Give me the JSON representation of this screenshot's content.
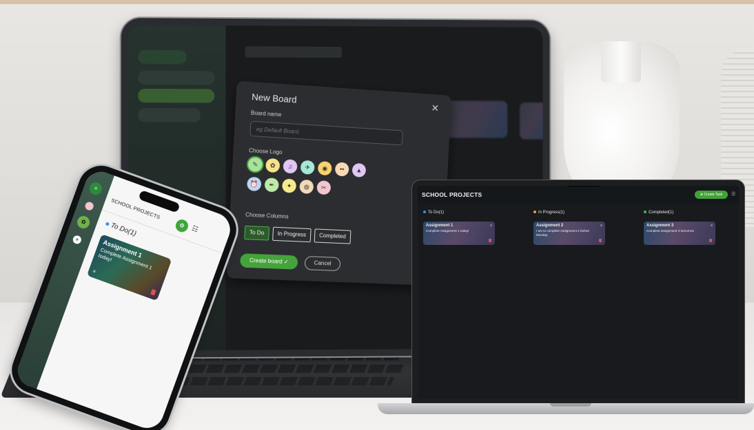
{
  "modal": {
    "title": "New Board",
    "board_name_label": "Board name",
    "board_name_placeholder": "eg Default Board.",
    "choose_logo_label": "Choose Logo",
    "logos": [
      {
        "icon": "✎",
        "color": "#a8e29a"
      },
      {
        "icon": "✿",
        "color": "#f6e38a"
      },
      {
        "icon": "♫",
        "color": "#e0c5f5"
      },
      {
        "icon": "✈",
        "color": "#a7e8d6"
      },
      {
        "icon": "◉",
        "color": "#f7d36b"
      },
      {
        "icon": "••",
        "color": "#f7d9b2"
      },
      {
        "icon": "▲",
        "color": "#e0c6f2"
      },
      {
        "icon": "⏰",
        "color": "#b6d8f5"
      },
      {
        "icon": "✒",
        "color": "#bfe9a8"
      },
      {
        "icon": "✦",
        "color": "#f6ea8c"
      },
      {
        "icon": "◍",
        "color": "#f2d9b8"
      },
      {
        "icon": "✂",
        "color": "#f4c6cf"
      }
    ],
    "choose_columns_label": "Choose Columns",
    "columns": [
      "To Do",
      "In Progress",
      "Completed"
    ],
    "create_label": "Create board ✓",
    "cancel_label": "Cancel"
  },
  "laptop": {
    "title": "SCHOOL PROJECTS",
    "create_task_label": "Create Task",
    "columns": [
      {
        "label": "To Do(1)",
        "dot_color": "#3b8ef0"
      },
      {
        "label": "In Progress(1)",
        "dot_color": "#e5a93b"
      },
      {
        "label": "Completed(1)",
        "dot_color": "#48b84a"
      }
    ],
    "cards": [
      {
        "title": "Assignment 1",
        "desc": "Complete Assignment 1 today!"
      },
      {
        "title": "Assignment 2",
        "desc": "I am to complete Assignment 2 before Monday."
      },
      {
        "title": "Assignment 3",
        "desc": "Complete assignment 3 tomorrow"
      }
    ]
  },
  "phone": {
    "title": "SCHOOL PROJECTS",
    "column_label": "To Do(1)",
    "card": {
      "title": "Assignment 1",
      "desc": "Complete Assignment 1 today!"
    }
  },
  "colors": {
    "accent": "#45a33b",
    "dark_bg": "#181a1d",
    "modal_bg": "#2c2d30"
  }
}
